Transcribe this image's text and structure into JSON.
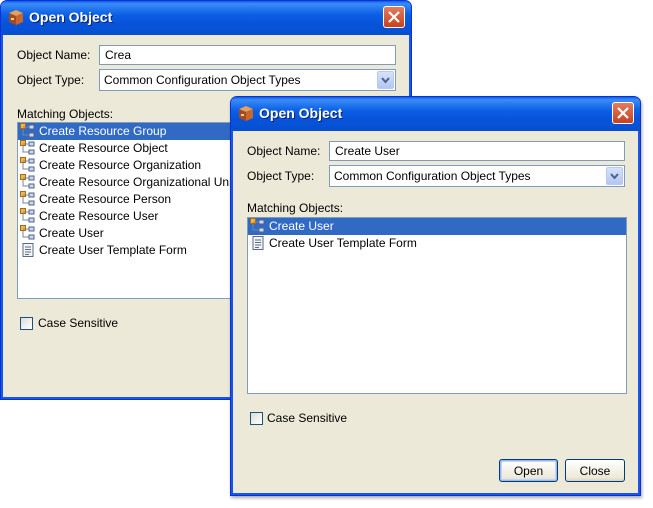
{
  "back_dialog": {
    "title": "Open Object",
    "object_name_label": "Object Name:",
    "object_name_value": "Crea",
    "object_type_label": "Object Type:",
    "object_type_value": "Common Configuration Object Types",
    "matching_label": "Matching Objects:",
    "items": [
      {
        "label": "Create Resource Group",
        "icon": "form-object-icon",
        "selected": true
      },
      {
        "label": "Create Resource Object",
        "icon": "form-object-icon",
        "selected": false
      },
      {
        "label": "Create Resource Organization",
        "icon": "form-object-icon",
        "selected": false
      },
      {
        "label": "Create Resource Organizational Unit",
        "icon": "form-object-icon",
        "selected": false
      },
      {
        "label": "Create Resource Person",
        "icon": "form-object-icon",
        "selected": false
      },
      {
        "label": "Create Resource User",
        "icon": "form-object-icon",
        "selected": false
      },
      {
        "label": "Create User",
        "icon": "form-object-icon",
        "selected": false
      },
      {
        "label": "Create User Template Form",
        "icon": "document-icon",
        "selected": false
      }
    ],
    "case_sensitive_label": "Case Sensitive",
    "case_sensitive_checked": false
  },
  "front_dialog": {
    "title": "Open Object",
    "object_name_label": "Object Name:",
    "object_name_value": "Create User",
    "object_type_label": "Object Type:",
    "object_type_value": "Common Configuration Object Types",
    "matching_label": "Matching Objects:",
    "items": [
      {
        "label": "Create User",
        "icon": "form-object-icon",
        "selected": true
      },
      {
        "label": "Create User Template Form",
        "icon": "document-icon",
        "selected": false
      }
    ],
    "case_sensitive_label": "Case Sensitive",
    "case_sensitive_checked": false,
    "open_label": "Open",
    "close_label": "Close"
  },
  "colors": {
    "titlebar": "#0a5fe5",
    "selection": "#316ac5",
    "dialog_bg": "#ece9d8",
    "close_button": "#c7401f"
  }
}
